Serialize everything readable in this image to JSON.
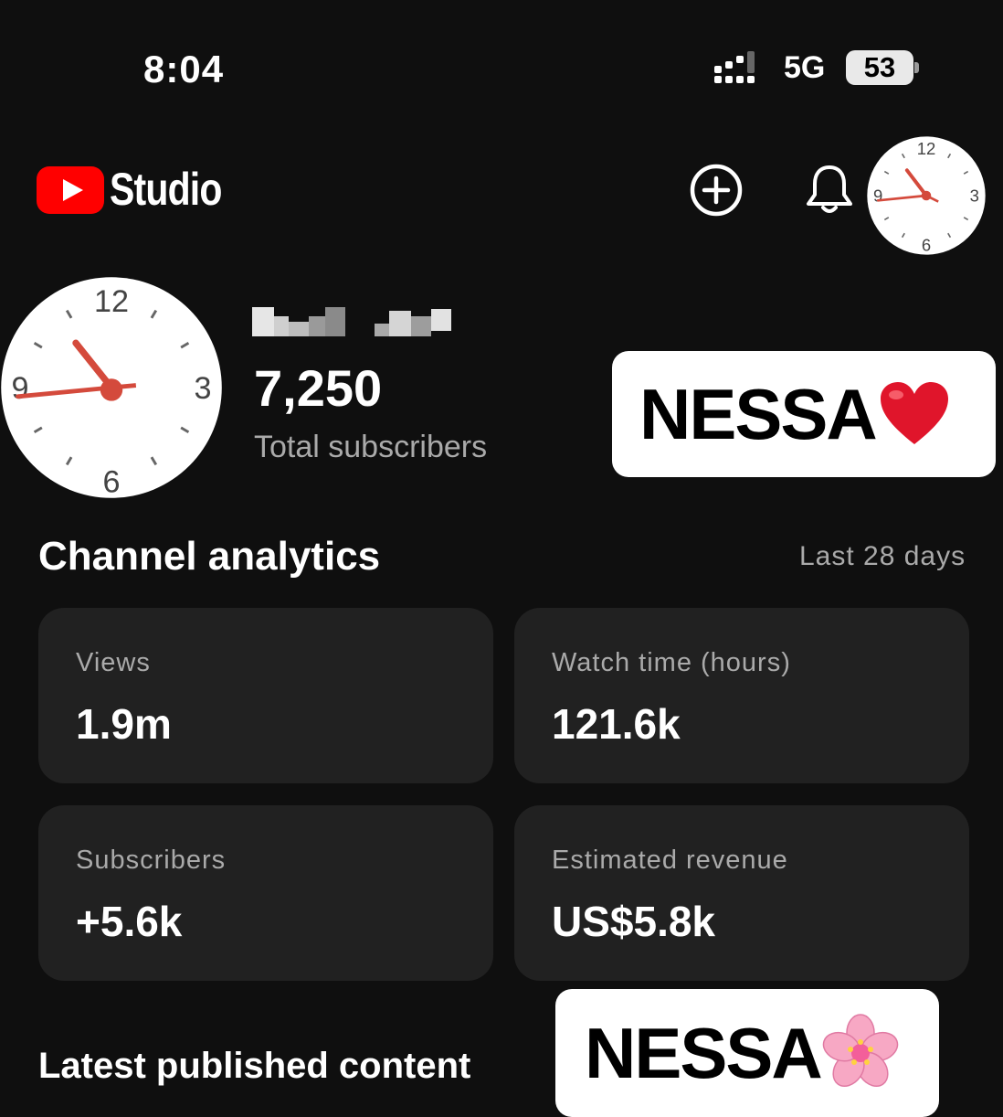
{
  "status_bar": {
    "time": "8:04",
    "network": "5G",
    "battery": "53"
  },
  "header": {
    "app_name": "Studio",
    "icons": [
      "youtube-logo-icon",
      "create-icon",
      "bell-icon",
      "avatar"
    ]
  },
  "channel": {
    "subscriber_count": "7,250",
    "subscriber_label": "Total subscribers"
  },
  "stickers": [
    {
      "text": "NESSA",
      "emoji": "❤️"
    },
    {
      "text": "NESSA",
      "emoji": "🌸"
    }
  ],
  "analytics": {
    "title": "Channel analytics",
    "period": "Last 28 days",
    "cards": [
      {
        "label": "Views",
        "value": "1.9m"
      },
      {
        "label": "Watch time (hours)",
        "value": "121.6k"
      },
      {
        "label": "Subscribers",
        "value": "+5.6k"
      },
      {
        "label": "Estimated revenue",
        "value": "US$5.8k"
      }
    ]
  },
  "latest": {
    "title": "Latest published content"
  },
  "colors": {
    "background": "#0f0f0f",
    "card": "#212121",
    "brand_red": "#ff0000",
    "secondary_text": "#aaaaaa"
  }
}
